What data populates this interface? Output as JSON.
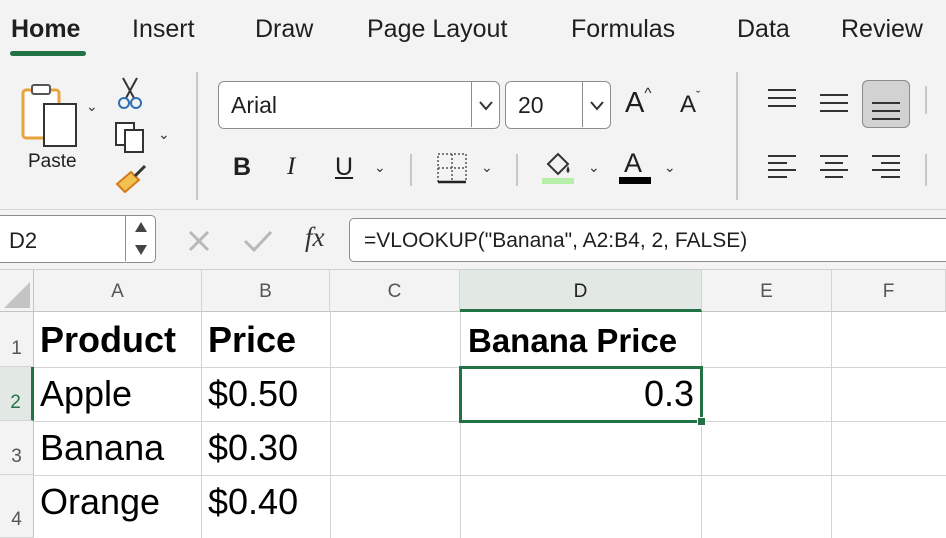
{
  "ribbon_tabs": [
    {
      "label": "Home",
      "active": true
    },
    {
      "label": "Insert"
    },
    {
      "label": "Draw"
    },
    {
      "label": "Page Layout"
    },
    {
      "label": "Formulas"
    },
    {
      "label": "Data"
    },
    {
      "label": "Review"
    }
  ],
  "clipboard": {
    "paste_label": "Paste"
  },
  "font": {
    "family": "Arial",
    "size": "20"
  },
  "format_buttons": {
    "bold": "B",
    "italic": "I",
    "underline": "U",
    "grow": "A",
    "shrink": "A",
    "font_color": "A"
  },
  "colors": {
    "accent": "#217346",
    "fill_color": "#b6f0a8",
    "font_color": "#000000"
  },
  "formula_bar": {
    "name_box": "D2",
    "fx_label": "fx",
    "formula": "=VLOOKUP(\"Banana\", A2:B4, 2, FALSE)"
  },
  "sheet": {
    "columns": [
      "A",
      "B",
      "C",
      "D",
      "E",
      "F"
    ],
    "selected_column": "D",
    "rows": [
      "1",
      "2",
      "3",
      "4"
    ],
    "selected_row": "2",
    "cells": {
      "A1": "Product",
      "B1": "Price",
      "D1": "Banana Price",
      "A2": "Apple",
      "B2": "$0.50",
      "D2": "0.3",
      "A3": "Banana",
      "B3": "$0.30",
      "A4": "Orange",
      "B4": "$0.40"
    }
  }
}
